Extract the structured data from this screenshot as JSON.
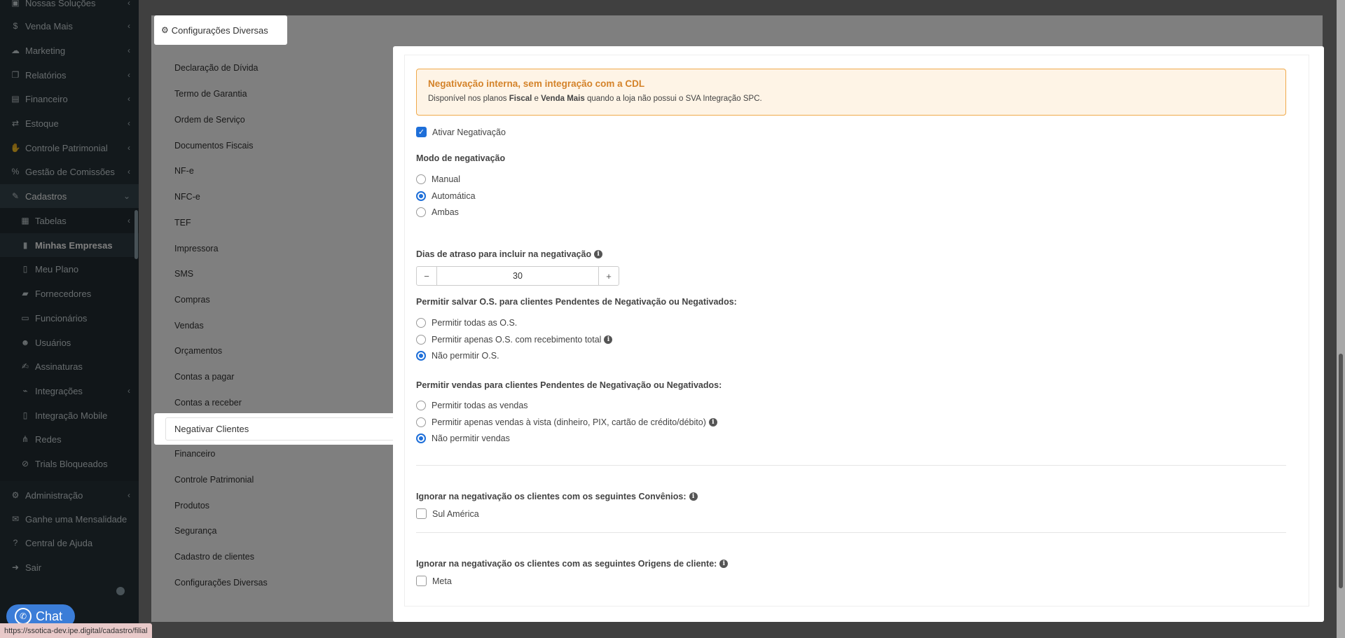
{
  "sidebar": {
    "items": [
      {
        "label": "Nossas Soluções",
        "icon": "box-icon",
        "chev": true
      },
      {
        "label": "Venda Mais",
        "icon": "dollar-icon",
        "chev": true
      },
      {
        "label": "Marketing",
        "icon": "chat-icon",
        "chev": true
      },
      {
        "label": "Relatórios",
        "icon": "copy-icon",
        "chev": true
      },
      {
        "label": "Financeiro",
        "icon": "money-icon",
        "chev": true
      },
      {
        "label": "Estoque",
        "icon": "exchange-icon",
        "chev": true
      },
      {
        "label": "Controle Patrimonial",
        "icon": "hand-icon",
        "chev": true
      },
      {
        "label": "Gestão de Comissões",
        "icon": "percent-icon",
        "chev": true
      },
      {
        "label": "Cadastros",
        "icon": "edit-icon",
        "chev": true
      }
    ],
    "sub_items": [
      {
        "label": "Tabelas",
        "icon": "table-icon",
        "chev": true
      },
      {
        "label": "Minhas Empresas",
        "icon": "building-icon",
        "chev": false
      },
      {
        "label": "Meu Plano",
        "icon": "file-icon",
        "chev": false
      },
      {
        "label": "Fornecedores",
        "icon": "truck-icon",
        "chev": false
      },
      {
        "label": "Funcionários",
        "icon": "folder-icon",
        "chev": false
      },
      {
        "label": "Usuários",
        "icon": "users-icon",
        "chev": false
      },
      {
        "label": "Assinaturas",
        "icon": "signature-icon",
        "chev": false
      },
      {
        "label": "Integrações",
        "icon": "plug-icon",
        "chev": true
      },
      {
        "label": "Integração Mobile",
        "icon": "mobile-icon",
        "chev": false
      },
      {
        "label": "Redes",
        "icon": "network-icon",
        "chev": false
      },
      {
        "label": "Trials Bloqueados",
        "icon": "ban-icon",
        "chev": false
      }
    ],
    "bottom_items": [
      {
        "label": "Administração",
        "icon": "cogs-icon",
        "chev": true
      },
      {
        "label": "Ganhe uma Mensalidade",
        "icon": "gift-icon",
        "chev": false
      },
      {
        "label": "Central de Ajuda",
        "icon": "question-icon",
        "chev": false
      },
      {
        "label": "Sair",
        "icon": "sign-out-icon",
        "chev": false
      }
    ]
  },
  "chat_label": "Chat",
  "status_url": "https://ssotica-dev.ipe.digital/cadastro/filial",
  "header": {
    "title": "Configurações Diversas"
  },
  "settings_menu": [
    "Declaração de Dívida",
    "Termo de Garantia",
    "Ordem de Serviço",
    "Documentos Fiscais",
    "NF-e",
    "NFC-e",
    "TEF",
    "Impressora",
    "SMS",
    "Compras",
    "Vendas",
    "Orçamentos",
    "Contas a pagar",
    "Contas a receber",
    "Negativar Clientes",
    "Financeiro",
    "Controle Patrimonial",
    "Produtos",
    "Segurança",
    "Cadastro de clientes",
    "Configurações Diversas"
  ],
  "panel": {
    "alert": {
      "title": "Negativação interna, sem integração com a CDL",
      "d1": "Disponível nos planos ",
      "b1": "Fiscal",
      "d2": " e ",
      "b2": "Venda Mais",
      "d3": " quando a loja não possui o SVA Integração SPC."
    },
    "activate_label": "Ativar Negativação",
    "mode_label": "Modo de negativação",
    "mode_options": [
      "Manual",
      "Automática",
      "Ambas"
    ],
    "mode_selected": 1,
    "days_label": "Dias de atraso para incluir na negativação",
    "days_value": "30",
    "stepper_minus": "−",
    "stepper_plus": "+",
    "os_label": "Permitir salvar O.S. para clientes Pendentes de Negativação ou Negativados:",
    "os_options": [
      "Permitir todas as O.S.",
      "Permitir apenas O.S. com recebimento total",
      "Não permitir O.S."
    ],
    "os_selected": 2,
    "sales_label": "Permitir vendas para clientes Pendentes de Negativação ou Negativados:",
    "sales_options": [
      "Permitir todas as vendas",
      "Permitir apenas vendas à vista (dinheiro, PIX, cartão de crédito/débito)",
      "Não permitir vendas"
    ],
    "sales_selected": 2,
    "convenios_label": "Ignorar na negativação os clientes com os seguintes Convênios:",
    "convenio_option": "Sul América",
    "origens_label": "Ignorar na negativação os clientes com as seguintes Origens de cliente:",
    "origem_option": "Meta"
  }
}
